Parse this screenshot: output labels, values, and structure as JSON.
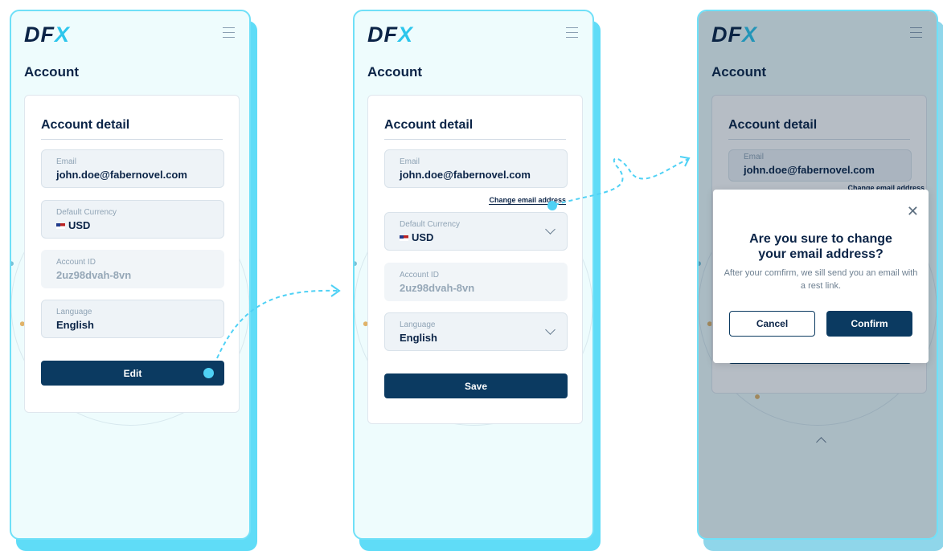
{
  "brand": {
    "logo_main": "DF",
    "logo_accent": "X"
  },
  "screens": [
    {
      "page_title": "Account",
      "card_title": "Account detail",
      "email": {
        "label": "Email",
        "value": "john.doe@fabernovel.com"
      },
      "currency": {
        "label": "Default Currency",
        "value": "USD"
      },
      "account_id": {
        "label": "Account ID",
        "value": "2uz98dvah-8vn"
      },
      "language": {
        "label": "Language",
        "value": "English"
      },
      "button_label": "Edit"
    },
    {
      "page_title": "Account",
      "card_title": "Account detail",
      "email": {
        "label": "Email",
        "value": "john.doe@fabernovel.com"
      },
      "change_email_link": "Change email address",
      "currency": {
        "label": "Default Currency",
        "value": "USD"
      },
      "account_id": {
        "label": "Account ID",
        "value": "2uz98dvah-8vn"
      },
      "language": {
        "label": "Language",
        "value": "English"
      },
      "button_label": "Save"
    },
    {
      "page_title": "Account",
      "card_title": "Account detail",
      "email": {
        "label": "Email",
        "value": "john.doe@fabernovel.com"
      },
      "change_email_link": "Change email address",
      "modal": {
        "title": "Are you sure to change your email address?",
        "body": "After your comfirm, we sill send you an email with a rest link.",
        "cancel_label": "Cancel",
        "confirm_label": "Confirm"
      }
    }
  ],
  "colors": {
    "primary": "#0b3a61",
    "accent": "#4fd1f5",
    "background": "#eefcfd"
  },
  "icons": {
    "menu": "hamburger-icon",
    "close": "close-icon",
    "chevron": "chevron-down-icon",
    "flag": "us-flag-icon"
  }
}
